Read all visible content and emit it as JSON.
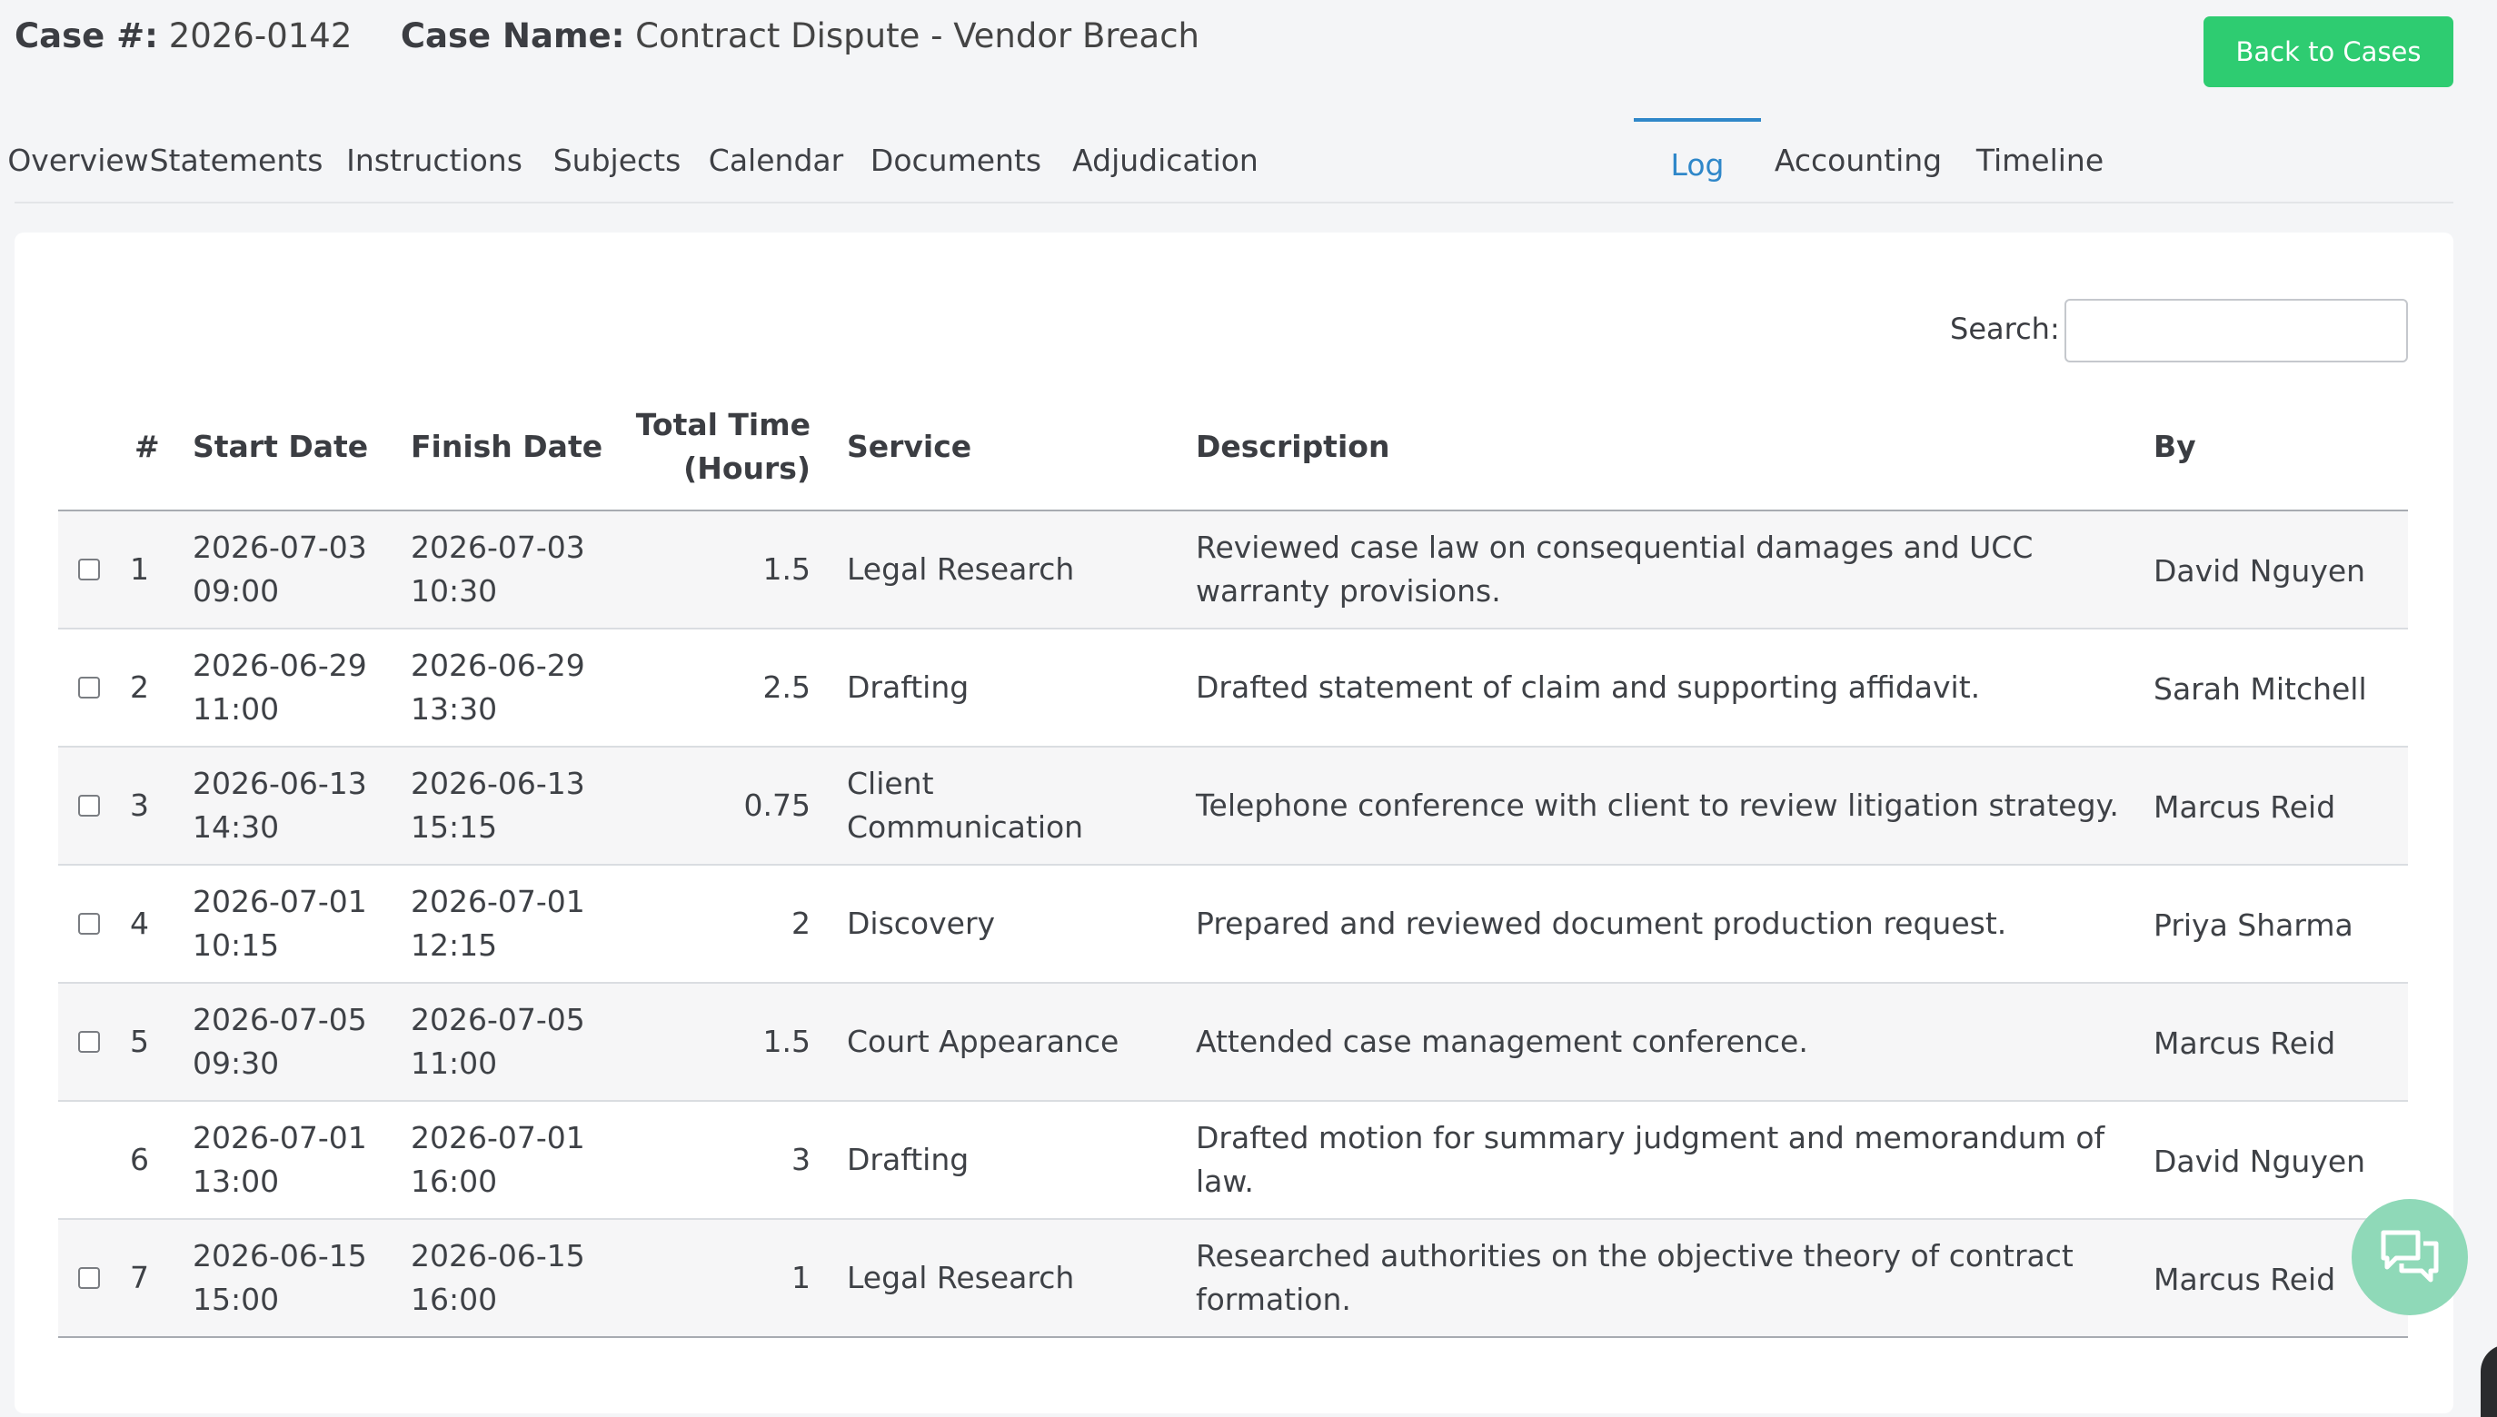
{
  "header": {
    "case_number_label": "Case #:",
    "case_number": "2026-0142",
    "case_name_label": "Case Name:",
    "case_name": "Contract Dispute - Vendor Breach",
    "back_button": "Back to Cases"
  },
  "tabs": [
    {
      "label": "Overview"
    },
    {
      "label": "Statements"
    },
    {
      "label": "Instructions"
    },
    {
      "label": "Subjects"
    },
    {
      "label": "Calendar"
    },
    {
      "label": "Documents"
    },
    {
      "label": "Adjudication"
    },
    {
      "label": "Log",
      "active": true
    },
    {
      "label": "Accounting"
    },
    {
      "label": "Timeline"
    }
  ],
  "search": {
    "label": "Search:",
    "value": ""
  },
  "table": {
    "columns": {
      "num": "#",
      "start": "Start Date",
      "finish": "Finish Date",
      "total_line1": "Total Time",
      "total_line2": "(Hours)",
      "service": "Service",
      "description": "Description",
      "by": "By"
    },
    "rows": [
      {
        "num": "1",
        "has_checkbox": true,
        "start_date": "2026-07-03",
        "start_time": "09:00",
        "finish_date": "2026-07-03",
        "finish_time": "10:30",
        "total": "1.5",
        "service": "Legal Research",
        "desc1": "Reviewed case law on consequential damages and UCC",
        "desc2": "warranty provisions.",
        "by": "David Nguyen"
      },
      {
        "num": "2",
        "has_checkbox": true,
        "start_date": "2026-06-29",
        "start_time": "11:00",
        "finish_date": "2026-06-29",
        "finish_time": "13:30",
        "total": "2.5",
        "service": "Drafting",
        "desc1": "Drafted statement of claim and supporting affidavit.",
        "desc2": "",
        "by": "Sarah Mitchell"
      },
      {
        "num": "3",
        "has_checkbox": true,
        "start_date": "2026-06-13",
        "start_time": "14:30",
        "finish_date": "2026-06-13",
        "finish_time": "15:15",
        "total": "0.75",
        "service": "Client",
        "service2": "Communication",
        "desc1": "Telephone conference with client to review litigation strategy.",
        "desc2": "",
        "by": "Marcus Reid"
      },
      {
        "num": "4",
        "has_checkbox": true,
        "start_date": "2026-07-01",
        "start_time": "10:15",
        "finish_date": "2026-07-01",
        "finish_time": "12:15",
        "total": "2",
        "service": "Discovery",
        "desc1": "Prepared and reviewed document production request.",
        "desc2": "",
        "by": "Priya Sharma"
      },
      {
        "num": "5",
        "has_checkbox": true,
        "start_date": "2026-07-05",
        "start_time": "09:30",
        "finish_date": "2026-07-05",
        "finish_time": "11:00",
        "total": "1.5",
        "service": "Court Appearance",
        "desc1": "Attended case management conference.",
        "desc2": "",
        "by": "Marcus Reid"
      },
      {
        "num": "6",
        "has_checkbox": false,
        "start_date": "2026-07-01",
        "start_time": "13:00",
        "finish_date": "2026-07-01",
        "finish_time": "16:00",
        "total": "3",
        "service": "Drafting",
        "desc1": "Drafted motion for summary judgment and memorandum of",
        "desc2": "law.",
        "by": "David Nguyen"
      },
      {
        "num": "7",
        "has_checkbox": true,
        "start_date": "2026-06-15",
        "start_time": "15:00",
        "finish_date": "2026-06-15",
        "finish_time": "16:00",
        "total": "1",
        "service": "Legal Research",
        "desc1": "Researched authorities on the objective theory of contract",
        "desc2": "formation.",
        "by": "Marcus Reid"
      }
    ]
  },
  "chat": {
    "icon": "chat-bubbles-icon"
  }
}
